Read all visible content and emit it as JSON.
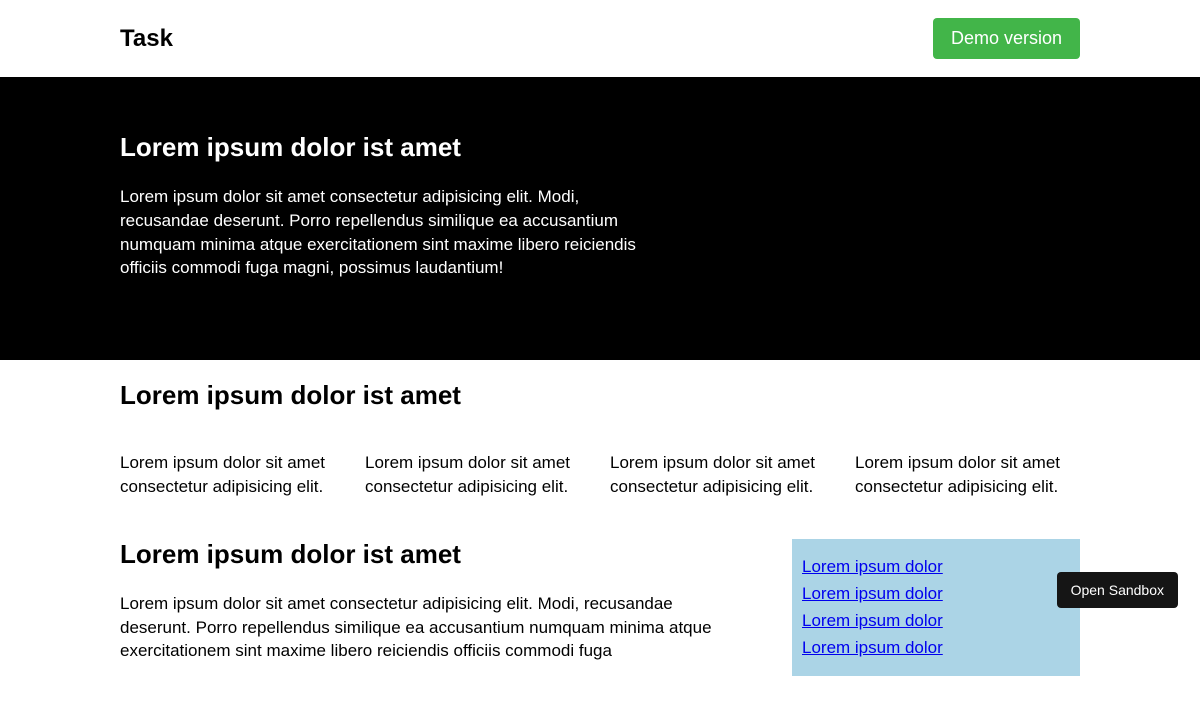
{
  "header": {
    "brand": "Task",
    "demo_button": "Demo version"
  },
  "hero": {
    "title": "Lorem ipsum dolor ist amet",
    "body": "Lorem ipsum dolor sit amet consectetur adipisicing elit. Modi, recusandae deserunt. Porro repellendus similique ea accusantium numquam minima atque exercitationem sint maxime libero reiciendis officiis commodi fuga magni, possimus laudantium!"
  },
  "features": {
    "title": "Lorem ipsum dolor ist amet",
    "items": [
      "Lorem ipsum dolor sit amet consectetur adipisicing elit.",
      "Lorem ipsum dolor sit amet consectetur adipisicing elit.",
      "Lorem ipsum dolor sit amet consectetur adipisicing elit.",
      "Lorem ipsum dolor sit amet consectetur adipisicing elit."
    ]
  },
  "article": {
    "title": "Lorem ipsum dolor ist amet",
    "body": "Lorem ipsum dolor sit amet consectetur adipisicing elit. Modi, recusandae deserunt. Porro repellendus similique ea accusantium numquam minima atque exercitationem sint maxime libero reiciendis officiis commodi fuga"
  },
  "aside": {
    "links": [
      "Lorem ipsum dolor",
      "Lorem ipsum dolor",
      "Lorem ipsum dolor",
      "Lorem ipsum dolor"
    ]
  },
  "sandbox_button": "Open Sandbox"
}
